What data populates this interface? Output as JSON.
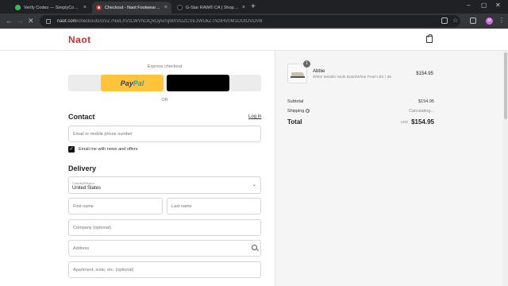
{
  "browser": {
    "tabs": [
      {
        "title": "Verify Codes — SimplyCodes",
        "fav_color": "#3cba54"
      },
      {
        "title": "Checkout - Naot Footwear US",
        "fav_color": "#d02e2e"
      },
      {
        "title": "G-Star RAW® CA | Shop Raw Denim…",
        "fav_color": "#111111"
      }
    ],
    "active_tab": 1,
    "url_host": "naot.com",
    "url_path": "/checkouts/cn/Z7NwLXVzLWVhc3QxOjAvSjI8XVDZCVE1WUkZTNzlHV0M1OUtOVDVB",
    "profile_initial": "M"
  },
  "header": {
    "logo": "Naot"
  },
  "express": {
    "label": "Express checkout",
    "paypal_pay": "Pay",
    "paypal_pal": "Pal",
    "or_label": "OR"
  },
  "contact": {
    "heading": "Contact",
    "login": "Log in",
    "email_placeholder": "Email or mobile phone number",
    "newsletter_label": "Email me with news and offers",
    "newsletter_checked": true
  },
  "delivery": {
    "heading": "Delivery",
    "country_label": "Country/Region",
    "country_value": "United States",
    "first_name_placeholder": "First name",
    "last_name_placeholder": "Last name",
    "company_placeholder": "Company (optional)",
    "address_placeholder": "Address",
    "apartment_placeholder": "Apartment, suite, etc. (optional)"
  },
  "summary": {
    "item": {
      "qty": "1",
      "name": "Abbie",
      "variant": "White Metallic Multi Braid/White Pearl Lthr / 35",
      "price": "$154.95"
    },
    "subtotal_label": "Subtotal",
    "subtotal_value": "$154.95",
    "shipping_label": "Shipping",
    "shipping_value": "Calculating...",
    "total_label": "Total",
    "currency": "USD",
    "total_value": "$154.95"
  }
}
